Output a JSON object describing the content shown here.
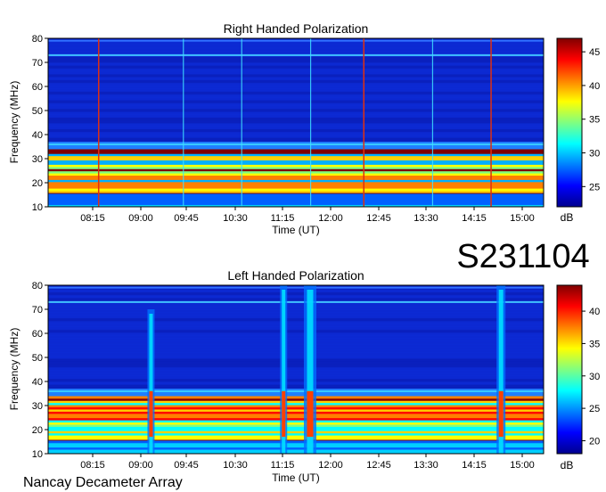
{
  "chart_data": [
    {
      "type": "heatmap",
      "title": "Right Handed Polarization",
      "xlabel": "Time (UT)",
      "ylabel": "Frequency (MHz)",
      "x_ticks": [
        "08:15",
        "09:00",
        "09:45",
        "10:30",
        "11:15",
        "12:00",
        "12:45",
        "13:30",
        "14:15",
        "15:00"
      ],
      "y_ticks": [
        10,
        20,
        30,
        40,
        50,
        60,
        70,
        80
      ],
      "ylim": [
        10,
        80
      ],
      "colorbar": {
        "label": "dB",
        "range": [
          22,
          47
        ],
        "ticks": [
          25,
          30,
          35,
          40,
          45
        ]
      },
      "colormap": [
        "#00008f",
        "#0000ff",
        "#0080ff",
        "#00ffff",
        "#80ff80",
        "#ffff00",
        "#ff8000",
        "#ff0000",
        "#800000"
      ],
      "features": {
        "background_db": 23,
        "interference_bands_mhz": [
          73
        ],
        "strong_band_mhz": [
          15,
          33
        ],
        "red_vertical_lines_ut": [
          "08:20",
          "12:30",
          "14:30"
        ],
        "cyan_vertical_lines_ut": [
          "09:40",
          "10:35",
          "11:40",
          "13:35"
        ]
      }
    },
    {
      "type": "heatmap",
      "title": "Left Handed Polarization",
      "xlabel": "Time (UT)",
      "ylabel": "Frequency (MHz)",
      "x_ticks": [
        "08:15",
        "09:00",
        "09:45",
        "10:30",
        "11:15",
        "12:00",
        "12:45",
        "13:30",
        "14:15",
        "15:00"
      ],
      "y_ticks": [
        10,
        20,
        30,
        40,
        50,
        60,
        70,
        80
      ],
      "ylim": [
        10,
        80
      ],
      "colorbar": {
        "label": "dB",
        "range": [
          18,
          44
        ],
        "ticks": [
          20,
          25,
          30,
          35,
          40
        ]
      },
      "colormap": [
        "#00008f",
        "#0000ff",
        "#0080ff",
        "#00ffff",
        "#80ff80",
        "#ffff00",
        "#ff8000",
        "#ff0000",
        "#800000"
      ],
      "features": {
        "background_db": 20,
        "interference_bands_mhz": [
          73
        ],
        "strong_band_mhz": [
          15,
          33
        ],
        "bursts_ut": [
          "09:10",
          "11:15",
          "11:40",
          "14:40"
        ]
      }
    }
  ],
  "event_id": "S231104",
  "observatory": "Nancay Decameter Array"
}
